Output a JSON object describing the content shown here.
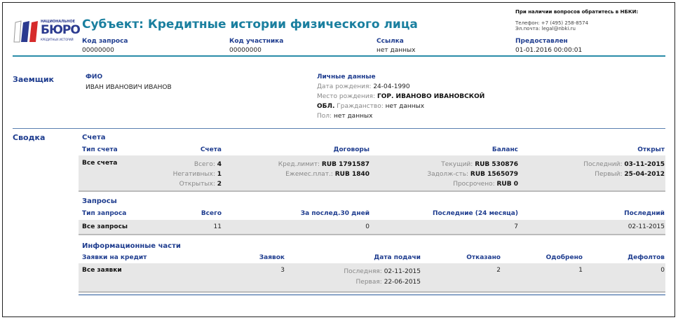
{
  "header": {
    "title": "Субъект: Кредитные истории физического лица",
    "logo_text": "НАЦИОНАЛЬНОЕ БЮРО КРЕДИТНЫХ ИСТОРИЙ",
    "fields": [
      {
        "label": "Код запроса",
        "value": "00000000"
      },
      {
        "label": "Код участника",
        "value": "00000000"
      },
      {
        "label": "Ссылка",
        "value": "нет данных"
      },
      {
        "label": "Предоставлен",
        "value": "01-01.2016 00:00:01"
      }
    ],
    "contact": {
      "heading": "При наличии вопросов обратитесь в НБКИ:",
      "phone": "Телефон: +7 (495) 258-8574",
      "email": "Эл.почта: legal@nbki.ru"
    }
  },
  "borrower": {
    "section": "Заемщик",
    "fio_label": "ФИО",
    "fio": "ИВАН ИВАНОВИЧ ИВАНОВ",
    "personal_label": "Личные данные",
    "birth_date_label": "Дата рождения:",
    "birth_date": "24-04-1990",
    "birth_place_label": "Место рождения:",
    "birth_place": "ГОР. ИВАНОВО ИВАНОВСКОЙ",
    "birth_place2": "ОБЛ.",
    "citizenship_label": "Гражданство:",
    "citizenship": "нет данных",
    "sex_label": "Пол:",
    "sex": "нет данных"
  },
  "summary": {
    "section": "Сводка",
    "accounts": {
      "title": "Счета",
      "headers": [
        "Тип счета",
        "Счета",
        "Договоры",
        "Баланс",
        "Открыт"
      ],
      "row_label": "Все счета",
      "counts": [
        {
          "k": "Всего:",
          "v": "4"
        },
        {
          "k": "Негативных:",
          "v": "1"
        },
        {
          "k": "Открытых:",
          "v": "2"
        }
      ],
      "contracts": [
        {
          "k": "Кред.лимит:",
          "v": "RUB 1791587"
        },
        {
          "k": "Ежемес.плат.:",
          "v": "RUB 1840"
        }
      ],
      "balance": [
        {
          "k": "Текущий:",
          "v": "RUB 530876"
        },
        {
          "k": "Задолж-сть:",
          "v": "RUB 1565079"
        },
        {
          "k": "Просрочено:",
          "v": "RUB 0"
        }
      ],
      "opened": [
        {
          "k": "Последний:",
          "v": "03-11-2015"
        },
        {
          "k": "Первый:",
          "v": "25-04-2012"
        }
      ]
    },
    "requests": {
      "title": "Запросы",
      "headers": [
        "Тип запроса",
        "Всего",
        "За послед.30 дней",
        "Последние (24 месяца)",
        "Последний"
      ],
      "row": [
        "Все запросы",
        "11",
        "0",
        "7",
        "02-11-2015"
      ]
    },
    "info": {
      "title": "Информационные части",
      "headers": [
        "Заявки на кредит",
        "Заявок",
        "Дата подачи",
        "Отказано",
        "Одобрено",
        "Дефолтов"
      ],
      "row_label": "Все заявки",
      "count": "3",
      "last_label": "Последняя:",
      "last": "02-11-2015",
      "first_label": "Первая:",
      "first": "22-06-2015",
      "refused": "2",
      "approved": "1",
      "defaults": "0"
    }
  },
  "colors": {
    "teal": "#1a7f9f",
    "blue": "#1f3d8f"
  }
}
